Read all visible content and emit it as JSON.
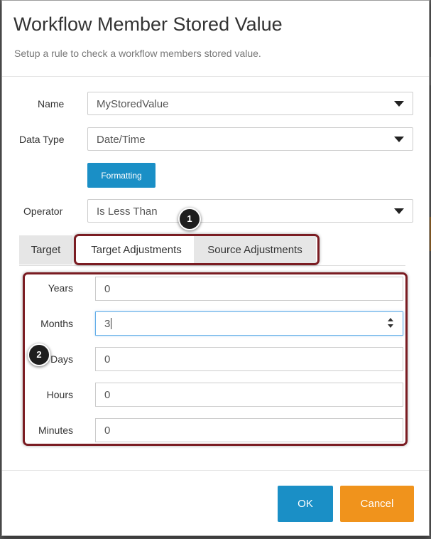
{
  "modal": {
    "title": "Workflow Member Stored Value",
    "subtitle": "Setup a rule to check a workflow members stored value."
  },
  "form": {
    "name_label": "Name",
    "name_value": "MyStoredValue",
    "data_type_label": "Data Type",
    "data_type_value": "Date/Time",
    "formatting_label": "Formatting",
    "operator_label": "Operator",
    "operator_value": "Is Less Than"
  },
  "tabs": [
    {
      "label": "Target",
      "active": true
    },
    {
      "label": "Target Adjustments",
      "active": false
    },
    {
      "label": "Source Adjustments",
      "active": false
    }
  ],
  "adjustments": [
    {
      "label": "Years",
      "value": "0"
    },
    {
      "label": "Months",
      "value": "3"
    },
    {
      "label": "Days",
      "value": "0"
    },
    {
      "label": "Hours",
      "value": "0"
    },
    {
      "label": "Minutes",
      "value": "0"
    }
  ],
  "callouts": {
    "one": "1",
    "two": "2"
  },
  "footer": {
    "ok_label": "OK",
    "cancel_label": "Cancel"
  },
  "colors": {
    "primary": "#1a8fc6",
    "cancel": "#f0931c",
    "callout_border": "#7a1c22"
  },
  "icons": {
    "select_caret": "chevron-down-icon",
    "spinner": "spinner-icon"
  }
}
